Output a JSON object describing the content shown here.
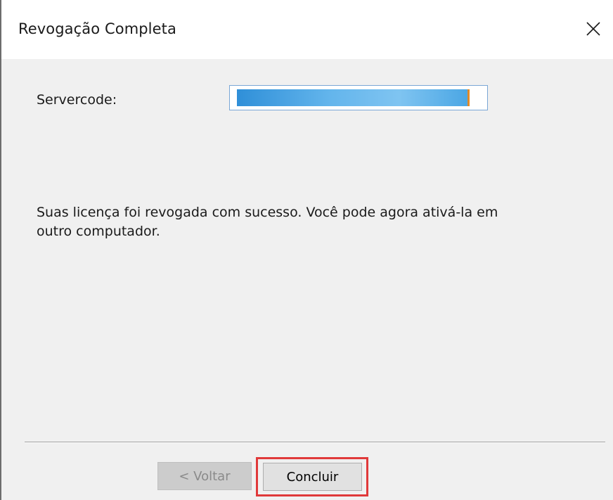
{
  "window": {
    "title": "Revogação Completa",
    "close_icon": "close-icon"
  },
  "form": {
    "servercode_label": "Servercode:",
    "servercode_value": ""
  },
  "message": {
    "line1": "Suas licença foi revogada com sucesso. Você pode agora ativá-la em",
    "line2": "outro computador."
  },
  "buttons": {
    "back_label": "< Voltar",
    "finish_label": "Concluir"
  },
  "colors": {
    "highlight": "#e0393a",
    "selection": "#3399e0"
  }
}
